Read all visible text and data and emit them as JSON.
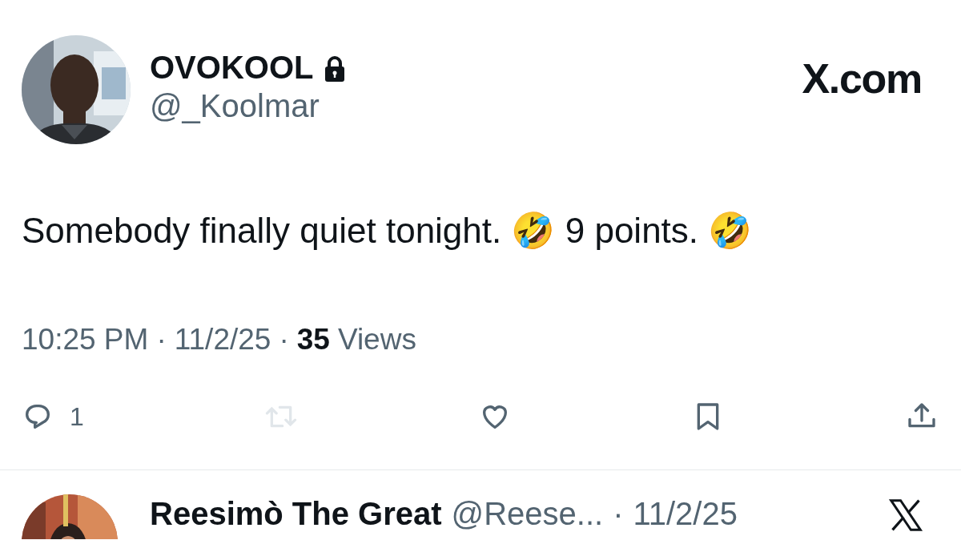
{
  "tweet": {
    "author": {
      "name": "OVOKOOL",
      "handle": "@_Koolmar",
      "protected": true
    },
    "brand": "X.com",
    "text": "Somebody finally quiet tonight. 🤣 9 points. 🤣",
    "time": "10:25 PM",
    "dot_1": "·",
    "date": "11/2/25",
    "dot_2": "·",
    "views_count": "35",
    "views_label": "Views",
    "actions": [
      {
        "kind": "reply",
        "count": "1",
        "disabled": false
      },
      {
        "kind": "retweet",
        "disabled": true
      },
      {
        "kind": "like",
        "disabled": false
      },
      {
        "kind": "bookmark",
        "disabled": false
      },
      {
        "kind": "share",
        "disabled": false
      }
    ]
  },
  "reply": {
    "name": "Reesimò The Great",
    "handle": "@Reese...",
    "dot": "·",
    "date": "11/2/25"
  }
}
